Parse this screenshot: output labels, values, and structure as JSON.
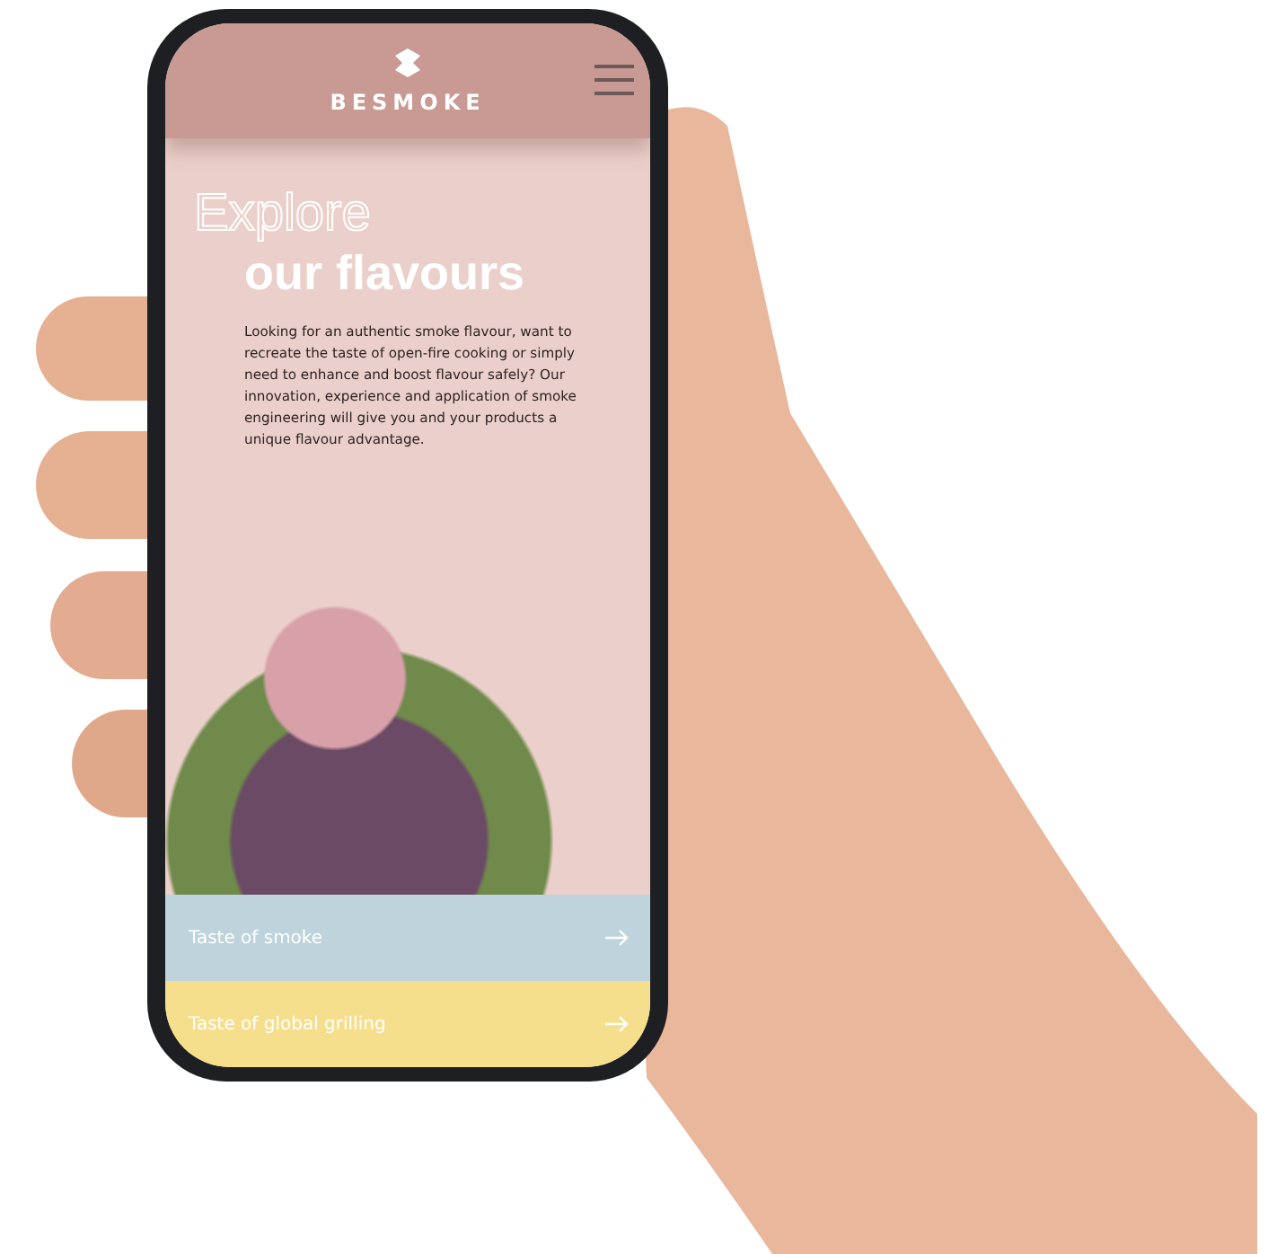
{
  "header": {
    "brand": "BESMOKE"
  },
  "hero": {
    "heading_outline": "Explore",
    "heading": "our flavours",
    "body": "Looking for an authentic smoke flavour, want to recreate the taste of open-fire cooking or simply need to enhance and boost flavour safely? Our innovation, experience and application of smoke engineering will give you and your products a unique flavour advantage."
  },
  "links": [
    {
      "label": "Taste of smoke",
      "color": "#bfd3dc"
    },
    {
      "label": "Taste of global grilling",
      "color": "#f6df8c"
    }
  ]
}
